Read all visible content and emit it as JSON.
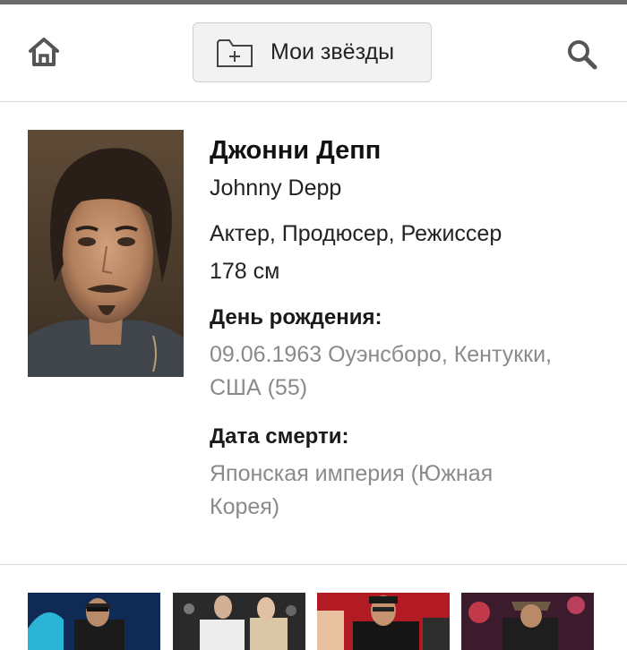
{
  "header": {
    "my_stars_label": "Мои звёзды",
    "icons": {
      "home": "home-icon",
      "folder_add": "folder-plus-icon",
      "search": "search-icon"
    }
  },
  "profile": {
    "name_ru": "Джонни Депп",
    "name_en": "Johnny Depp",
    "roles": "Актер, Продюсер, Режиссер",
    "height": "178 см",
    "birth": {
      "label": "День рождения:",
      "value_line1": "09.06.1963 Оуэнсборо, Кентукки,",
      "value_line2": "США (55)"
    },
    "death": {
      "label": "Дата смерти:",
      "value_line1": "Японская империя (Южная",
      "value_line2": "Корея)"
    }
  },
  "gallery": {
    "thumbnails": [
      "photo-1",
      "photo-2",
      "photo-3",
      "photo-4"
    ]
  },
  "colors": {
    "top_strip": "#6b6b6b",
    "muted_text": "#8a8a8a",
    "button_bg": "#f2f2f2"
  }
}
